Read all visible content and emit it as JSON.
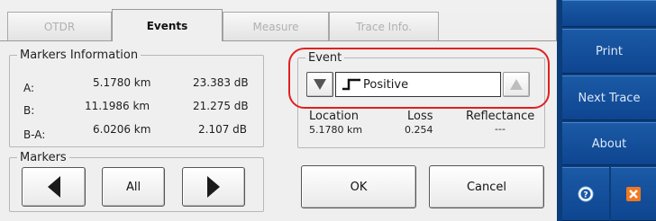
{
  "tabs": [
    {
      "label": "OTDR",
      "state": "disabled"
    },
    {
      "label": "Events",
      "state": "active"
    },
    {
      "label": "Measure",
      "state": "disabled"
    },
    {
      "label": "Trace Info.",
      "state": "disabled"
    }
  ],
  "markers_info": {
    "title": "Markers Information",
    "rows": [
      {
        "label": "A:",
        "distance": "5.1780 km",
        "loss": "23.383 dB"
      },
      {
        "label": "B:",
        "distance": "11.1986 km",
        "loss": "21.275 dB"
      },
      {
        "label": "B-A:",
        "distance": "6.0206 km",
        "loss": "2.107 dB"
      }
    ]
  },
  "markers": {
    "title": "Markers",
    "all_label": "All"
  },
  "event": {
    "title": "Event",
    "type_label": "Positive",
    "columns": [
      {
        "header": "Location",
        "value": "5.1780 km"
      },
      {
        "header": "Loss",
        "value": "0.254"
      },
      {
        "header": "Reflectance",
        "value": "---"
      }
    ]
  },
  "actions": {
    "ok_label": "OK",
    "cancel_label": "Cancel"
  },
  "sidebar": {
    "items": [
      {
        "label": "Print"
      },
      {
        "label": "Next Trace"
      },
      {
        "label": "About"
      }
    ]
  },
  "colors": {
    "sidebar_bg": "#0b3d7a",
    "sidebar_button": "#1b5aa6",
    "highlight": "#e02020",
    "close_icon": "#f07820"
  }
}
